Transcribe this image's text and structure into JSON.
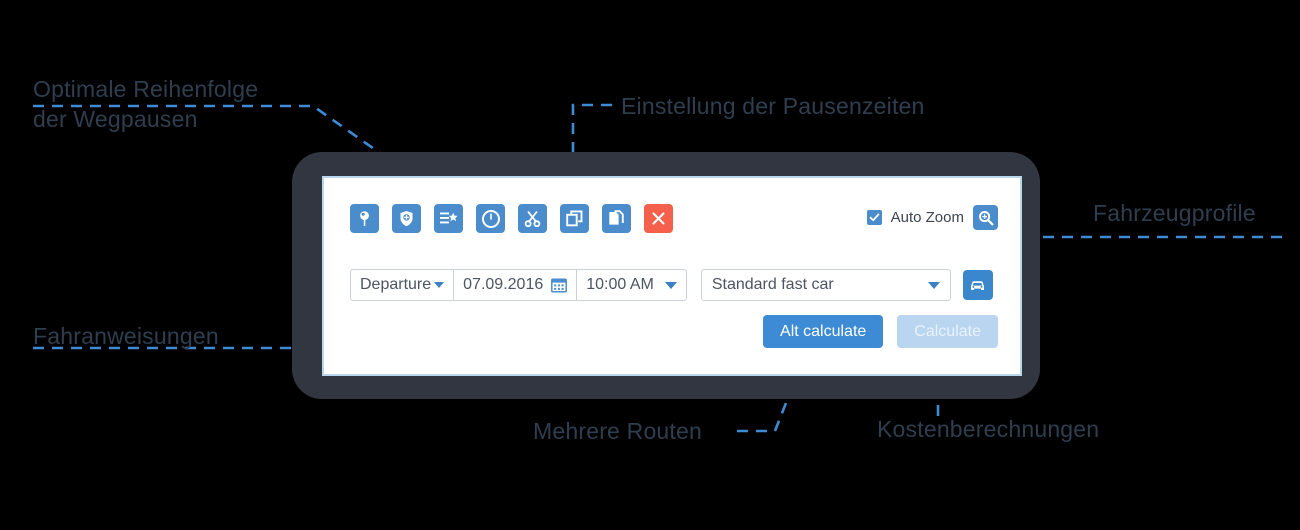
{
  "callouts": [
    {
      "id": "optimal-order",
      "text": "Optimale Reihenfolge\nder Wegpausen"
    },
    {
      "id": "break-settings",
      "text": "Einstellung der Pausenzeiten"
    },
    {
      "id": "driving-directions",
      "text": "Fahranweisungen"
    },
    {
      "id": "vehicle-profiles",
      "text": "Fahrzeugprofile"
    },
    {
      "id": "multiple-routes",
      "text": "Mehrere Routen"
    },
    {
      "id": "cost-calculations",
      "text": "Kostenberechnungen"
    }
  ],
  "app": {
    "toolbar": {
      "icons": [
        {
          "name": "map-pin-icon",
          "label": "Waypoint"
        },
        {
          "name": "shield-plus-icon",
          "label": "Add point"
        },
        {
          "name": "list-star-icon",
          "label": "Optimize order"
        },
        {
          "name": "clock-icon",
          "label": "Break times"
        },
        {
          "name": "scissors-icon",
          "label": "Split route"
        },
        {
          "name": "duplicate-icon",
          "label": "Duplicate"
        },
        {
          "name": "copy-pages-icon",
          "label": "Copy"
        },
        {
          "name": "close-x-icon",
          "label": "Clear"
        }
      ]
    },
    "auto_zoom": {
      "label": "Auto Zoom",
      "checked": true,
      "zoom_button_name": "zoom-in-icon"
    },
    "form": {
      "mode": "Departure",
      "date": "07.09.2016",
      "time": "10:00 AM",
      "date_icon": "calendar-icon",
      "profile_value": "Standard fast car",
      "vehicle_button_icon": "car-icon"
    },
    "buttons": {
      "alt_calculate": "Alt calculate",
      "calculate": "Calculate"
    }
  },
  "colors": {
    "accent_blue": "#4a8ccc",
    "button_blue": "#3d8bd4",
    "disabled_blue": "#b9d5ef",
    "red": "#f4604b",
    "device_dark": "#313640",
    "text_dark": "#2f3e4f",
    "connector": "#3d8bd4"
  }
}
